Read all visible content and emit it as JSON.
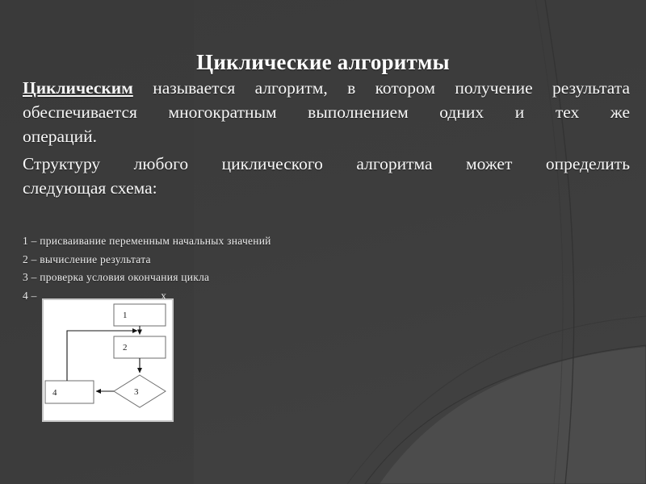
{
  "slide": {
    "title": "Циклические алгоритмы",
    "background_color": "#3c3c3c",
    "background_accent_color": "#4a4a4a",
    "text_color": "#f7f7f7"
  },
  "paragraphs": {
    "p1": {
      "lead": "Циклическим",
      "line1_rest": " называется алгоритм, в котором получение результата",
      "line2": "обеспечивается многократным выполнением одних и тех же",
      "line3": "операций."
    },
    "p2": {
      "line1": "Структуру любого циклического алгоритма может определить",
      "line2": "следующая схема:"
    }
  },
  "notes": {
    "line1": "1 – присваивание переменным начальных значений",
    "line2": "2 – вычисление результата",
    "line3": "3 – проверка условия окончания цикла",
    "line4": "4 – ",
    "line4_tail": "х"
  },
  "flowchart": {
    "nodes": {
      "n1": "1",
      "n2": "2",
      "n3": "3",
      "n4": "4"
    },
    "border_color": "#9a9a9a",
    "line_color": "#1f1f1f",
    "fill_color": "#ffffff"
  }
}
